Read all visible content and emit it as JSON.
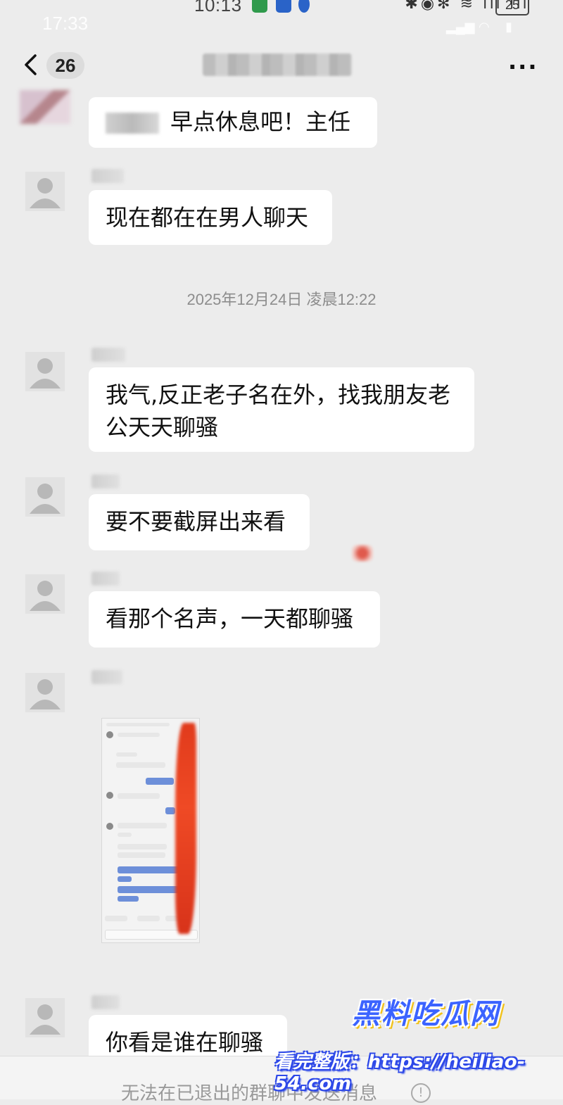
{
  "status_bar": {
    "outer_time": "10:13",
    "battery": "25",
    "inner_time": "17:33"
  },
  "header": {
    "unread_count": "26"
  },
  "messages": [
    {
      "id": "m1",
      "text": "早点休息吧！主任"
    },
    {
      "id": "m2",
      "text": "现在都在在男人聊天"
    },
    {
      "id": "m3",
      "text": "我气,反正老子名在外，找我朋友老公天天聊骚"
    },
    {
      "id": "m4",
      "text": "要不要截屏出来看"
    },
    {
      "id": "m5",
      "text": "看那个名声，一天都聊骚"
    },
    {
      "id": "m6",
      "text": "你看是谁在聊骚"
    }
  ],
  "timestamp": "2025年12月24日 凌晨12:22",
  "bottom_bar": {
    "notice": "无法在已退出的群聊中发送消息"
  },
  "watermark": {
    "title": "黑料吃瓜网",
    "url": "看完整版：https://heiliao-54.com"
  },
  "colors": {
    "background": "#ececec",
    "bubble": "#ffffff",
    "watermark_blue": "#3b63ff"
  },
  "icons": [
    "back-chevron-icon",
    "more-dots-icon",
    "person-silhouette-icon",
    "info-circle-icon",
    "wifi-icon",
    "signal-icon"
  ]
}
